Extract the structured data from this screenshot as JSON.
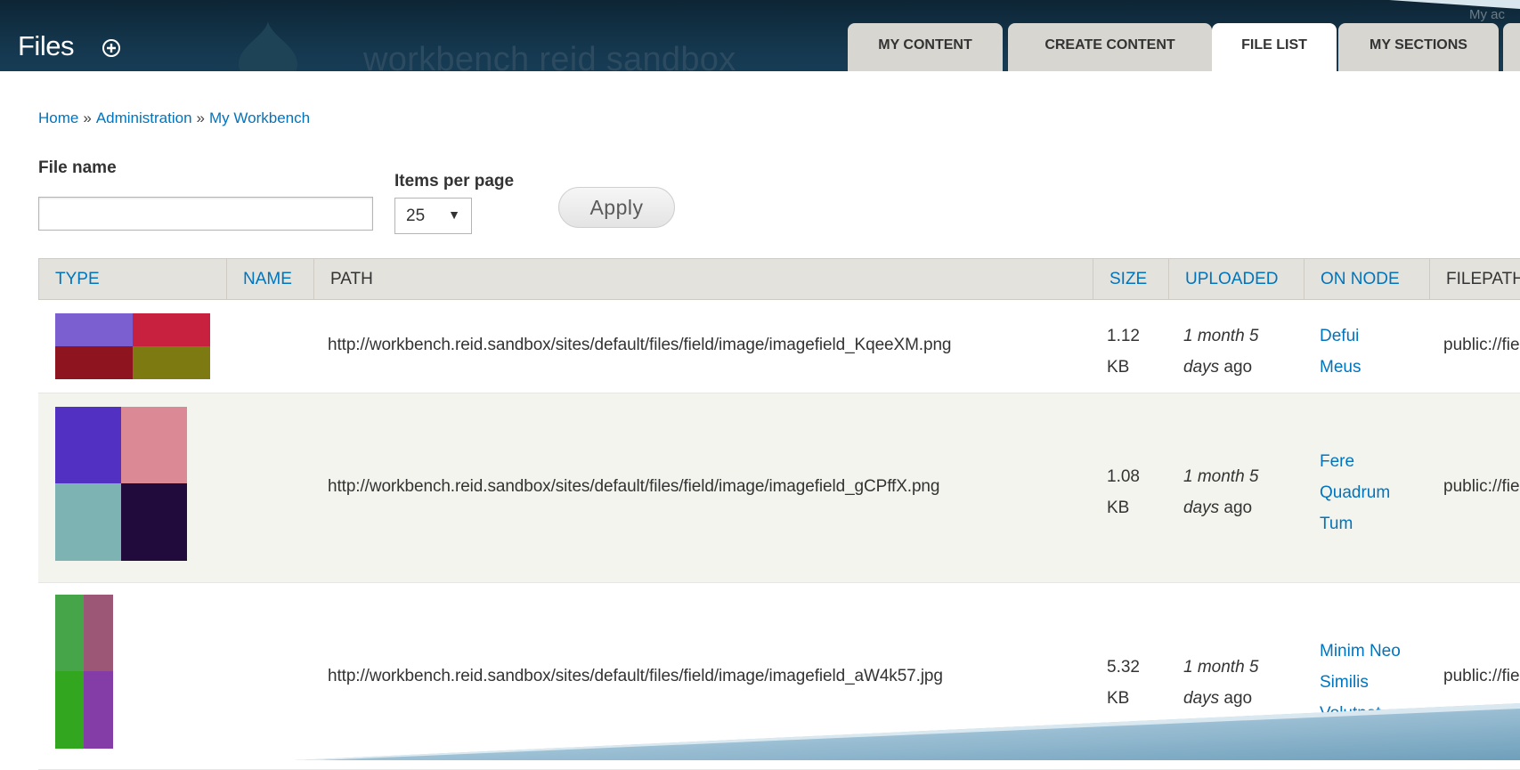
{
  "header": {
    "title": "Files",
    "site_name": "workbench reid sandbox",
    "user_hint": "My ac",
    "tabs": [
      {
        "label": "MY CONTENT",
        "active": false
      },
      {
        "label": "CREATE CONTENT",
        "active": false
      },
      {
        "label": "FILE LIST",
        "active": true
      },
      {
        "label": "MY SECTIONS",
        "active": false
      }
    ]
  },
  "breadcrumb": {
    "items": [
      "Home",
      "Administration",
      "My Workbench"
    ],
    "separator": "»"
  },
  "filters": {
    "file_name_label": "File name",
    "file_name_value": "",
    "items_per_page_label": "Items per page",
    "items_per_page_value": "25",
    "apply_label": "Apply"
  },
  "table": {
    "headers": {
      "type": "TYPE",
      "name": "NAME",
      "path": "PATH",
      "size": "SIZE",
      "uploaded": "UPLOADED",
      "on_node": "ON NODE",
      "filepath": "FILEPATH"
    },
    "rows": [
      {
        "thumb_colors": [
          "#7b5fd0",
          "#c8203f",
          "#8e1420",
          "#7e7a12"
        ],
        "name": "",
        "path": "http://workbench.reid.sandbox/sites/default/files/field/image/imagefield_KqeeXM.png",
        "size_value": "1.12",
        "size_unit": "KB",
        "uploaded_ital1": "1 month 5",
        "uploaded_ital2": "days",
        "uploaded_tail": "ago",
        "nodes": [
          "Defui",
          "Meus"
        ],
        "filepath": "public://field/ir"
      },
      {
        "thumb_colors": [
          "#5230c2",
          "#db8a95",
          "#7db3b2",
          "#210b3d"
        ],
        "name": "",
        "path": "http://workbench.reid.sandbox/sites/default/files/field/image/imagefield_gCPffX.png",
        "size_value": "1.08",
        "size_unit": "KB",
        "uploaded_ital1": "1 month 5",
        "uploaded_ital2": "days",
        "uploaded_tail": "ago",
        "nodes": [
          "Fere",
          "Quadrum",
          "Tum"
        ],
        "filepath": "public://field/ir"
      },
      {
        "thumb_colors": [
          "#46a449",
          "#9c5676",
          "#31a61e",
          "#843ca6"
        ],
        "name": "",
        "path": "http://workbench.reid.sandbox/sites/default/files/field/image/imagefield_aW4k57.jpg",
        "size_value": "5.32",
        "size_unit": "KB",
        "uploaded_ital1": "1 month 5",
        "uploaded_ital2": "days",
        "uploaded_tail": "ago",
        "nodes": [
          "Minim Neo",
          "Similis",
          "Volutpat"
        ],
        "filepath": "public://field/ir"
      }
    ]
  },
  "colors": {
    "header_bg": "#15384f",
    "link": "#0074bd",
    "tab_bg": "#d8d6d1",
    "table_header_bg": "#e3e2dc",
    "even_row_bg": "#f3f4ee",
    "slide_edge": "#9fc2d6"
  },
  "icons": {
    "shortcut": "circle-plus-icon",
    "logo": "drupal-drop-logo",
    "select_arrow": "caret-down-icon"
  }
}
